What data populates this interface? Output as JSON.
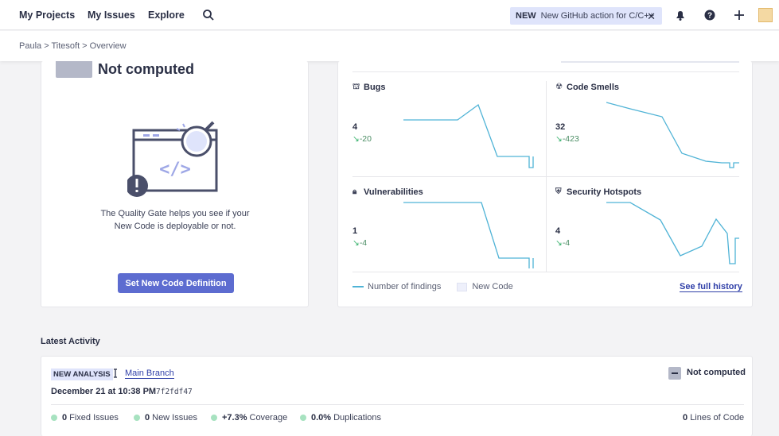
{
  "nav": {
    "my_projects": "My Projects",
    "my_issues": "My Issues",
    "explore": "Explore",
    "promo_badge": "NEW",
    "promo_text": "New GitHub action for C/C++",
    "promo_close": "✕"
  },
  "breadcrumb": "Paula > Titesoft > Overview",
  "quality_gate": {
    "status": "Not computed",
    "help_text": "The Quality Gate helps you see if your New Code is deployable or not.",
    "button": "Set New Code Definition"
  },
  "metrics": {
    "bugs": {
      "label": "Bugs",
      "value": "4",
      "delta": "-20"
    },
    "code_smells": {
      "label": "Code Smells",
      "value": "32",
      "delta": "-423"
    },
    "vulnerabilities": {
      "label": "Vulnerabilities",
      "value": "1",
      "delta": "-4"
    },
    "hotspots": {
      "label": "Security Hotspots",
      "value": "4",
      "delta": "-4"
    },
    "legend_findings": "Number of findings",
    "legend_new_code": "New Code",
    "full_history": "See full history"
  },
  "activity": {
    "title": "Latest Activity",
    "badge": "NEW ANALYSIS",
    "branch": "Main Branch",
    "status": "Not computed",
    "date": "December 21 at 10:38 PM",
    "hash": "7f2fdf47",
    "fixed_count": "0",
    "fixed_label": "Fixed Issues",
    "new_count": "0",
    "new_label": "New Issues",
    "coverage_value": "+7.3%",
    "coverage_label": "Coverage",
    "dup_value": "0.0%",
    "dup_label": "Duplications",
    "loc_value": "0",
    "loc_label": "Lines of Code"
  },
  "colors": {
    "accent": "#5d6cd0",
    "link": "#2f3fa8",
    "spark": "#4fb3d6",
    "positive": "#37b26c"
  }
}
